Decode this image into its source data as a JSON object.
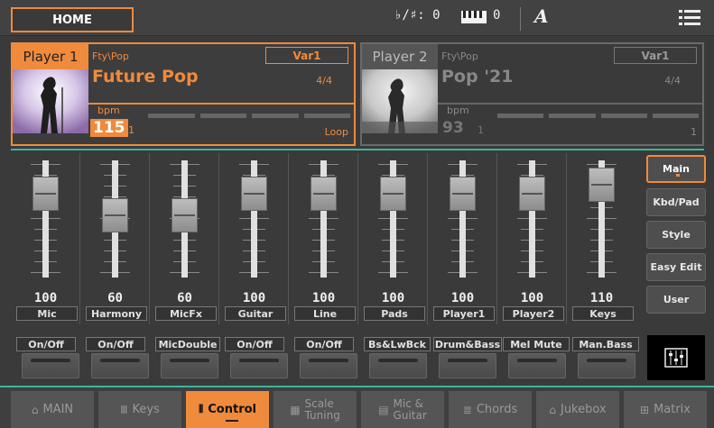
{
  "topbar": {
    "home_label": "HOME",
    "transpose_label": "♭/♯:",
    "transpose_value": "0",
    "octave_value": "0",
    "a_mark": "A"
  },
  "players": [
    {
      "tab": "Player 1",
      "category": "Fty\\Pop",
      "variation": "Var1",
      "name": "Future Pop",
      "meter": "4/4",
      "bpm_label": "bpm",
      "tempo": "115",
      "measure": "1",
      "loop": "Loop"
    },
    {
      "tab": "Player 2",
      "category": "Fty\\Pop",
      "variation": "Var1",
      "name": "Pop '21",
      "meter": "4/4",
      "bpm_label": "bpm",
      "tempo": "93",
      "measure": "1",
      "loop": "1"
    }
  ],
  "channels": [
    {
      "label": "Mic",
      "value": "100"
    },
    {
      "label": "Harmony",
      "value": "60"
    },
    {
      "label": "MicFx",
      "value": "60"
    },
    {
      "label": "Guitar",
      "value": "100"
    },
    {
      "label": "Line",
      "value": "100"
    },
    {
      "label": "Pads",
      "value": "100"
    },
    {
      "label": "Player1",
      "value": "100"
    },
    {
      "label": "Player2",
      "value": "100"
    },
    {
      "label": "Keys",
      "value": "110"
    }
  ],
  "side_buttons": [
    {
      "label": "Main",
      "active": true
    },
    {
      "label": "Kbd/Pad",
      "active": false
    },
    {
      "label": "Style",
      "active": false
    },
    {
      "label": "Easy Edit",
      "active": false
    },
    {
      "label": "User",
      "active": false
    }
  ],
  "switches": [
    "On/Off",
    "On/Off",
    "MicDouble",
    "On/Off",
    "On/Off",
    "Bs&LwBck",
    "Drum&Bass",
    "Mel Mute",
    "Man.Bass"
  ],
  "bottom_tabs": [
    {
      "icon": "home-icon",
      "label": "MAIN"
    },
    {
      "icon": "keys-icon",
      "label": "Keys"
    },
    {
      "icon": "control-icon",
      "label": "Control",
      "active": true
    },
    {
      "icon": "scale-icon",
      "label": "Scale",
      "label2": "Tuning"
    },
    {
      "icon": "mic-icon",
      "label": "Mic &",
      "label2": "Guitar"
    },
    {
      "icon": "chords-icon",
      "label": "Chords"
    },
    {
      "icon": "jukebox-icon",
      "label": "Jukebox"
    },
    {
      "icon": "matrix-icon",
      "label": "Matrix"
    }
  ],
  "colors": {
    "accent": "#f08a3c",
    "teal": "#3bb79b"
  }
}
